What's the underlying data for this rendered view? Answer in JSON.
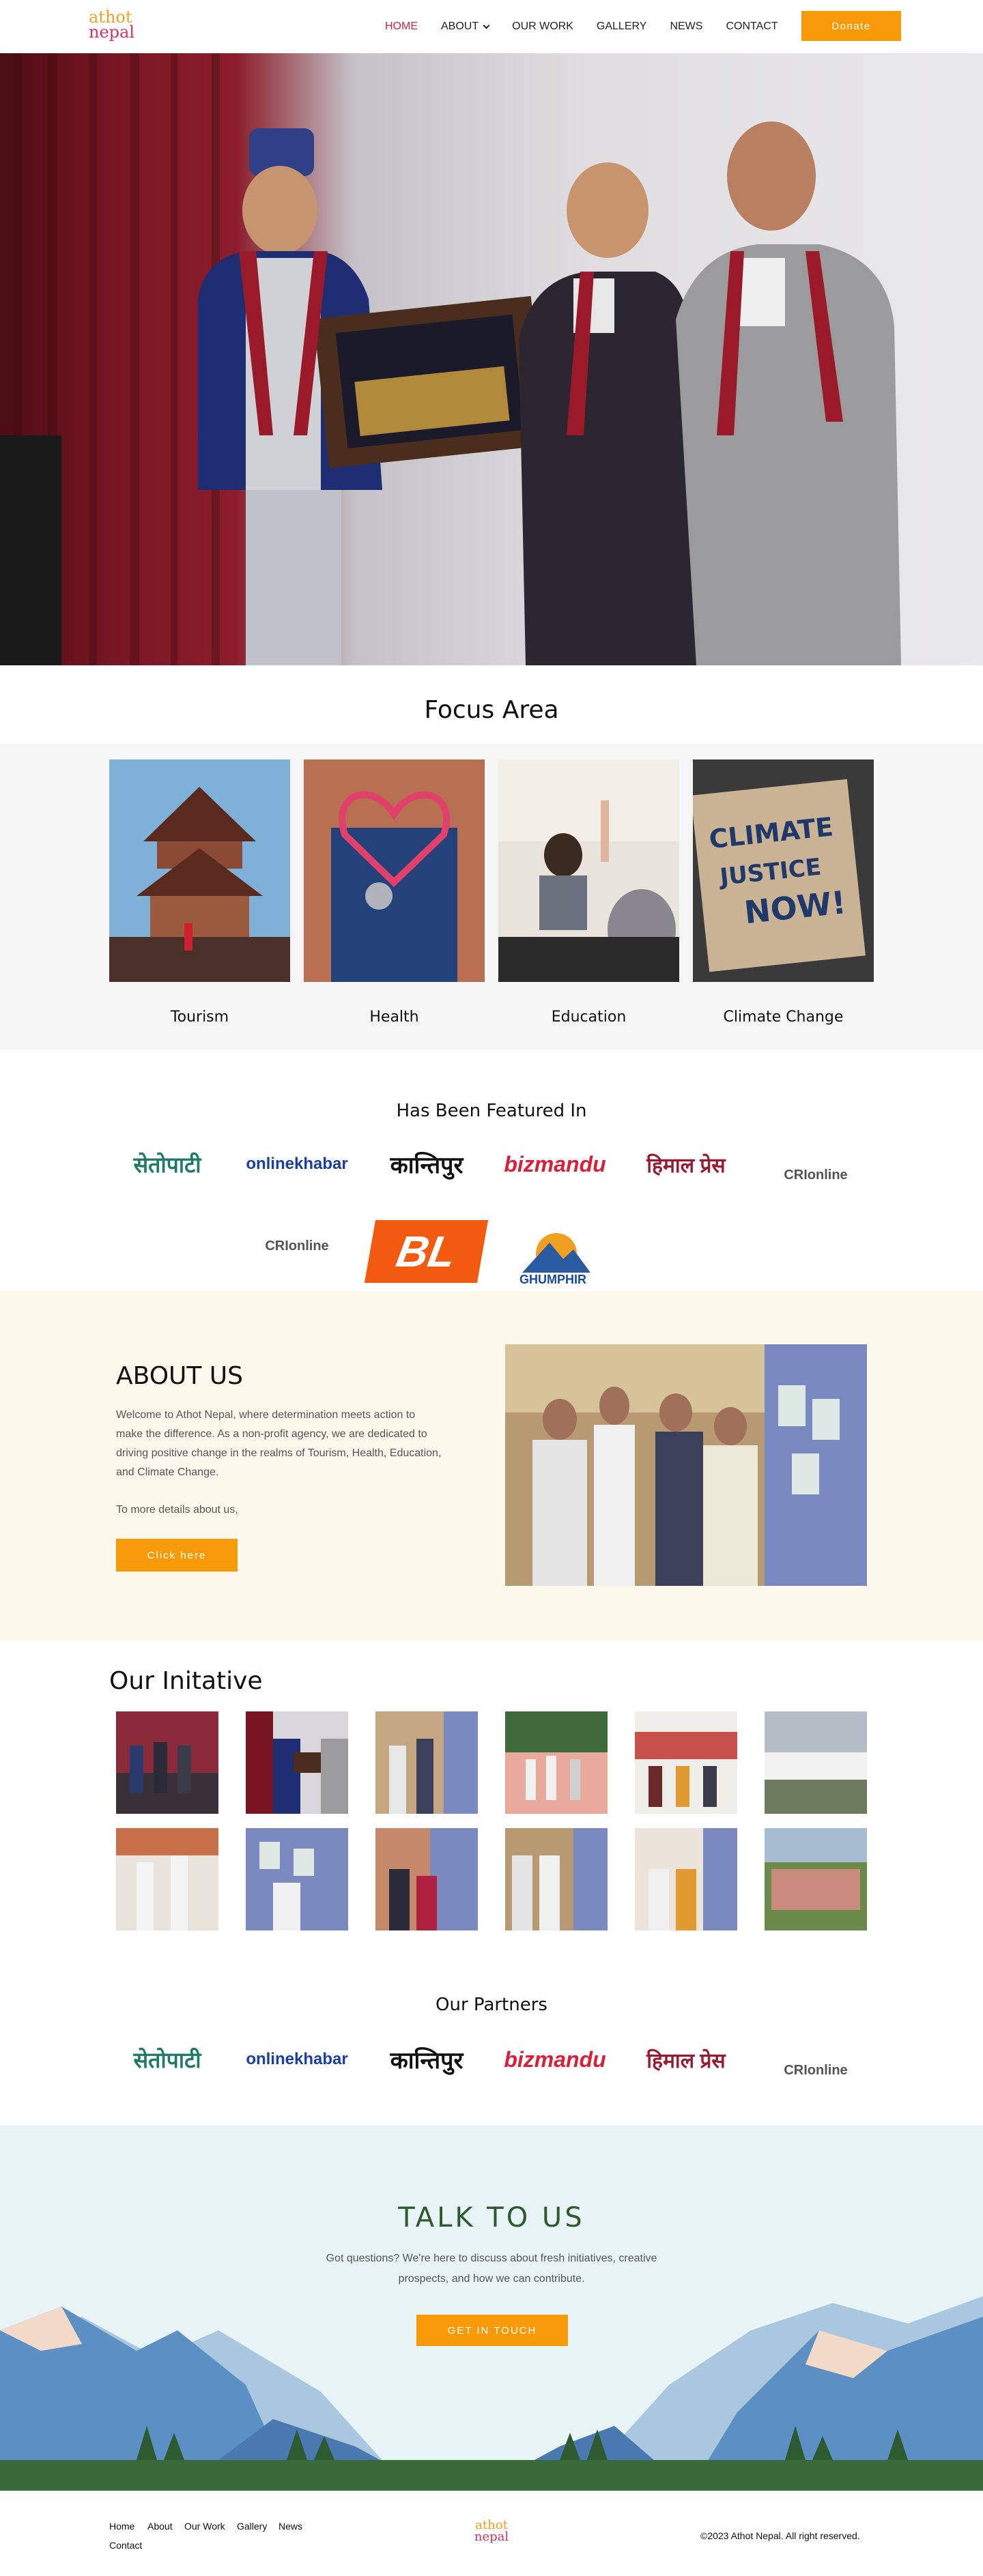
{
  "logo": {
    "line1": "athot",
    "line2": "nepal"
  },
  "nav": {
    "items": [
      "HOME",
      "ABOUT",
      "OUR WORK",
      "GALLERY",
      "NEWS",
      "CONTACT"
    ],
    "donate": "Donate"
  },
  "focus": {
    "title": "Focus Area",
    "cards": [
      "Tourism",
      "Health",
      "Education",
      "Climate Change"
    ]
  },
  "featured": {
    "title": "Has Been Featured In",
    "logos": [
      "सेतोपाटी",
      "onlinekhabar",
      "कान्तिपुर",
      "bizmandu",
      "हिमाल प्रेस",
      "CRIonline",
      "CRIonline",
      "BL",
      "GHUMPHIR"
    ]
  },
  "about": {
    "title": "ABOUT US",
    "body": "Welcome to Athot Nepal, where determination meets action to make the difference. As a non-profit agency, we are dedicated to driving positive change in the realms of Tourism, Health, Education, and Climate Change.",
    "more": "To more details about us,",
    "button": "Click here"
  },
  "initiative": {
    "title": "Our Initative"
  },
  "partners": {
    "title": "Our Partners",
    "logos": [
      "सेतोपाटी",
      "onlinekhabar",
      "कान्तिपुर",
      "bizmandu",
      "हिमाल प्रेस",
      "CRIonline"
    ]
  },
  "talk": {
    "title": "TALK TO US",
    "body": "Got questions? We're here to discuss about fresh initiatives, creative prospects, and how we can contribute.",
    "button": "GET IN TOUCH"
  },
  "footer": {
    "links": [
      "Home",
      "About",
      "Our Work",
      "Gallery",
      "News",
      "Contact"
    ],
    "copyright": "©2023 Athot Nepal. All right reserved."
  },
  "colors": {
    "accent": "#f79a0a",
    "brand_red": "#d02642",
    "talk_title": "#2d5a2f"
  }
}
